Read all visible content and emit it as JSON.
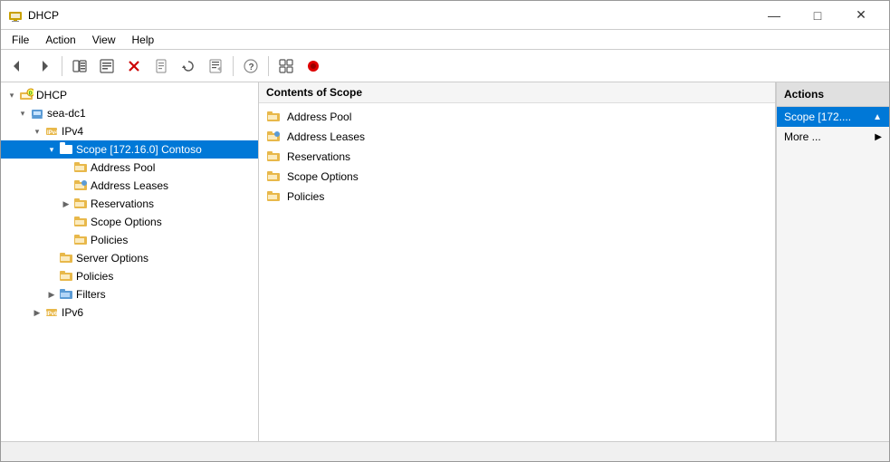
{
  "window": {
    "title": "DHCP",
    "controls": {
      "minimize": "—",
      "maximize": "□",
      "close": "✕"
    }
  },
  "menubar": {
    "items": [
      {
        "label": "File"
      },
      {
        "label": "Action"
      },
      {
        "label": "View"
      },
      {
        "label": "Help"
      }
    ]
  },
  "toolbar": {
    "buttons": [
      {
        "name": "back",
        "icon": "←"
      },
      {
        "name": "forward",
        "icon": "→"
      },
      {
        "name": "up",
        "icon": "⬆"
      },
      {
        "name": "show-hide",
        "icon": "▦"
      },
      {
        "name": "delete",
        "icon": "✕"
      },
      {
        "name": "properties",
        "icon": "📄"
      },
      {
        "name": "refresh",
        "icon": "↺"
      },
      {
        "name": "export",
        "icon": "⬒"
      },
      {
        "name": "help",
        "icon": "?"
      },
      {
        "name": "view-options",
        "icon": "⬚"
      },
      {
        "name": "record",
        "icon": "⏺"
      }
    ]
  },
  "tree": {
    "root": {
      "label": "DHCP",
      "children": [
        {
          "label": "sea-dc1",
          "expanded": true,
          "children": [
            {
              "label": "IPv4",
              "expanded": true,
              "children": [
                {
                  "label": "Scope [172.16.0] Contoso",
                  "selected": true,
                  "expanded": true,
                  "children": [
                    {
                      "label": "Address Pool"
                    },
                    {
                      "label": "Address Leases"
                    },
                    {
                      "label": "Reservations",
                      "expandable": true
                    },
                    {
                      "label": "Scope Options"
                    },
                    {
                      "label": "Policies"
                    }
                  ]
                },
                {
                  "label": "Server Options"
                },
                {
                  "label": "Policies"
                },
                {
                  "label": "Filters",
                  "expandable": true,
                  "children": []
                }
              ]
            },
            {
              "label": "IPv6",
              "expandable": true
            }
          ]
        }
      ]
    }
  },
  "contents": {
    "header": "Contents of Scope",
    "items": [
      {
        "label": "Address Pool"
      },
      {
        "label": "Address Leases"
      },
      {
        "label": "Reservations"
      },
      {
        "label": "Scope Options"
      },
      {
        "label": "Policies"
      }
    ]
  },
  "actions": {
    "header": "Actions",
    "scope_label": "Scope [172....",
    "more_label": "More ..."
  },
  "statusbar": {
    "text": ""
  }
}
